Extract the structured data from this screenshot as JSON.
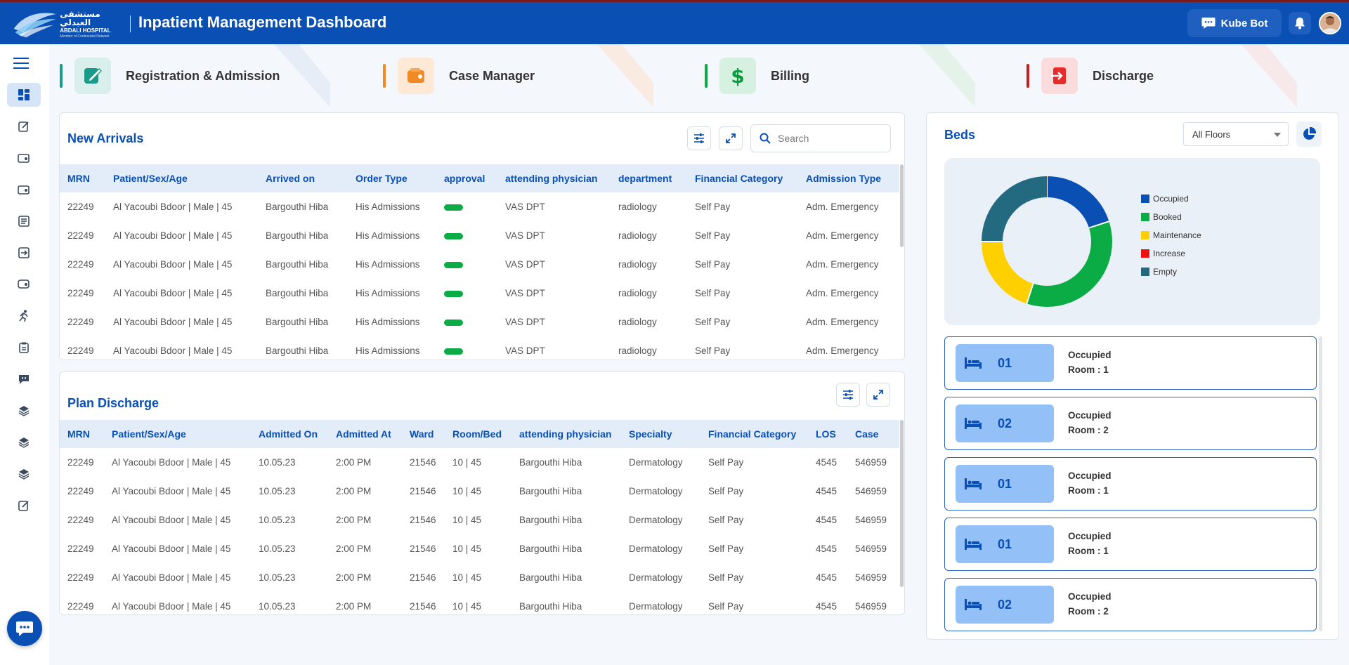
{
  "header": {
    "logo_arabic": "مستشفى العبدلي",
    "logo_english": "ABDALI HOSPITAL",
    "logo_tagline": "Member of Continental Network",
    "title": "Inpatient Management Dashboard",
    "kubebot_label": "Kube Bot"
  },
  "modules": [
    {
      "label": "Registration & Admission",
      "color": "#1a9a8a",
      "icon": "edit-document-icon"
    },
    {
      "label": "Case Manager",
      "color": "#f08a24",
      "icon": "wallet-icon"
    },
    {
      "label": "Billing",
      "color": "#0bab45",
      "icon": "dollar-icon"
    },
    {
      "label": "Discharge",
      "color": "#e52b2b",
      "icon": "exit-icon"
    }
  ],
  "new_arrivals": {
    "title": "New Arrivals",
    "search_placeholder": "Search",
    "columns": [
      "MRN",
      "Patient/Sex/Age",
      "Arrived on",
      "Order Type",
      "approval",
      "attending physician",
      "department",
      "Financial Category",
      "Admission Type"
    ],
    "rows": [
      [
        "22249",
        "Al Yacoubi Bdoor | Male | 45",
        "Bargouthi Hiba",
        "His Admissions",
        "",
        "VAS DPT",
        "radiology",
        "Self Pay",
        "Adm. Emergency"
      ],
      [
        "22249",
        "Al Yacoubi Bdoor | Male | 45",
        "Bargouthi Hiba",
        "His Admissions",
        "",
        "VAS DPT",
        "radiology",
        "Self Pay",
        "Adm. Emergency"
      ],
      [
        "22249",
        "Al Yacoubi Bdoor | Male | 45",
        "Bargouthi Hiba",
        "His Admissions",
        "",
        "VAS DPT",
        "radiology",
        "Self Pay",
        "Adm. Emergency"
      ],
      [
        "22249",
        "Al Yacoubi Bdoor | Male | 45",
        "Bargouthi Hiba",
        "His Admissions",
        "",
        "VAS DPT",
        "radiology",
        "Self Pay",
        "Adm. Emergency"
      ],
      [
        "22249",
        "Al Yacoubi Bdoor | Male | 45",
        "Bargouthi Hiba",
        "His Admissions",
        "",
        "VAS DPT",
        "radiology",
        "Self Pay",
        "Adm. Emergency"
      ],
      [
        "22249",
        "Al Yacoubi Bdoor | Male | 45",
        "Bargouthi Hiba",
        "His Admissions",
        "",
        "VAS DPT",
        "radiology",
        "Self Pay",
        "Adm. Emergency"
      ]
    ]
  },
  "plan_discharge": {
    "title": "Plan Discharge",
    "columns": [
      "MRN",
      "Patient/Sex/Age",
      "Admitted On",
      "Admitted At",
      "Ward",
      "Room/Bed",
      "attending physician",
      "Specialty",
      "Financial Category",
      "LOS",
      "Case"
    ],
    "rows": [
      [
        "22249",
        "Al Yacoubi Bdoor | Male | 45",
        "10.05.23",
        "2:00 PM",
        "21546",
        "10 | 45",
        "Bargouthi Hiba",
        "Dermatology",
        "Self Pay",
        "4545",
        "546959"
      ],
      [
        "22249",
        "Al Yacoubi Bdoor | Male | 45",
        "10.05.23",
        "2:00 PM",
        "21546",
        "10 | 45",
        "Bargouthi Hiba",
        "Dermatology",
        "Self Pay",
        "4545",
        "546959"
      ],
      [
        "22249",
        "Al Yacoubi Bdoor | Male | 45",
        "10.05.23",
        "2:00 PM",
        "21546",
        "10 | 45",
        "Bargouthi Hiba",
        "Dermatology",
        "Self Pay",
        "4545",
        "546959"
      ],
      [
        "22249",
        "Al Yacoubi Bdoor | Male | 45",
        "10.05.23",
        "2:00 PM",
        "21546",
        "10 | 45",
        "Bargouthi Hiba",
        "Dermatology",
        "Self Pay",
        "4545",
        "546959"
      ],
      [
        "22249",
        "Al Yacoubi Bdoor | Male | 45",
        "10.05.23",
        "2:00 PM",
        "21546",
        "10 | 45",
        "Bargouthi Hiba",
        "Dermatology",
        "Self Pay",
        "4545",
        "546959"
      ],
      [
        "22249",
        "Al Yacoubi Bdoor | Male | 45",
        "10.05.23",
        "2:00 PM",
        "21546",
        "10 | 45",
        "Bargouthi Hiba",
        "Dermatology",
        "Self Pay",
        "4545",
        "546959"
      ]
    ]
  },
  "beds": {
    "title": "Beds",
    "floor_select": "All Floors",
    "legend": [
      {
        "label": "Occupied",
        "color": "#0a4fb4"
      },
      {
        "label": "Booked",
        "color": "#0bab45"
      },
      {
        "label": "Maintenance",
        "color": "#ffd000"
      },
      {
        "label": "Increase",
        "color": "#ee1111"
      },
      {
        "label": "Empty",
        "color": "#236a80"
      }
    ],
    "chart_segments": [
      {
        "label": "Occupied",
        "value": 20
      },
      {
        "label": "Booked",
        "value": 35
      },
      {
        "label": "Maintenance",
        "value": 20
      },
      {
        "label": "Increase",
        "value": 0
      },
      {
        "label": "Empty",
        "value": 25
      }
    ],
    "cards": [
      {
        "number": "01",
        "status": "Occupied",
        "room": "Room : 1"
      },
      {
        "number": "02",
        "status": "Occupied",
        "room": "Room : 2"
      },
      {
        "number": "01",
        "status": "Occupied",
        "room": "Room : 1"
      },
      {
        "number": "01",
        "status": "Occupied",
        "room": "Room : 1"
      },
      {
        "number": "02",
        "status": "Occupied",
        "room": "Room : 2"
      }
    ]
  },
  "sidebar": {
    "icons": [
      "dashboard-icon",
      "edit-icon",
      "wallet-icon",
      "wallet-icon",
      "list-icon",
      "transfer-icon",
      "bed-icon",
      "runner-icon",
      "clipboard-icon",
      "chat-icon",
      "layers-icon",
      "layers-icon",
      "layers-icon",
      "edit-icon"
    ]
  }
}
